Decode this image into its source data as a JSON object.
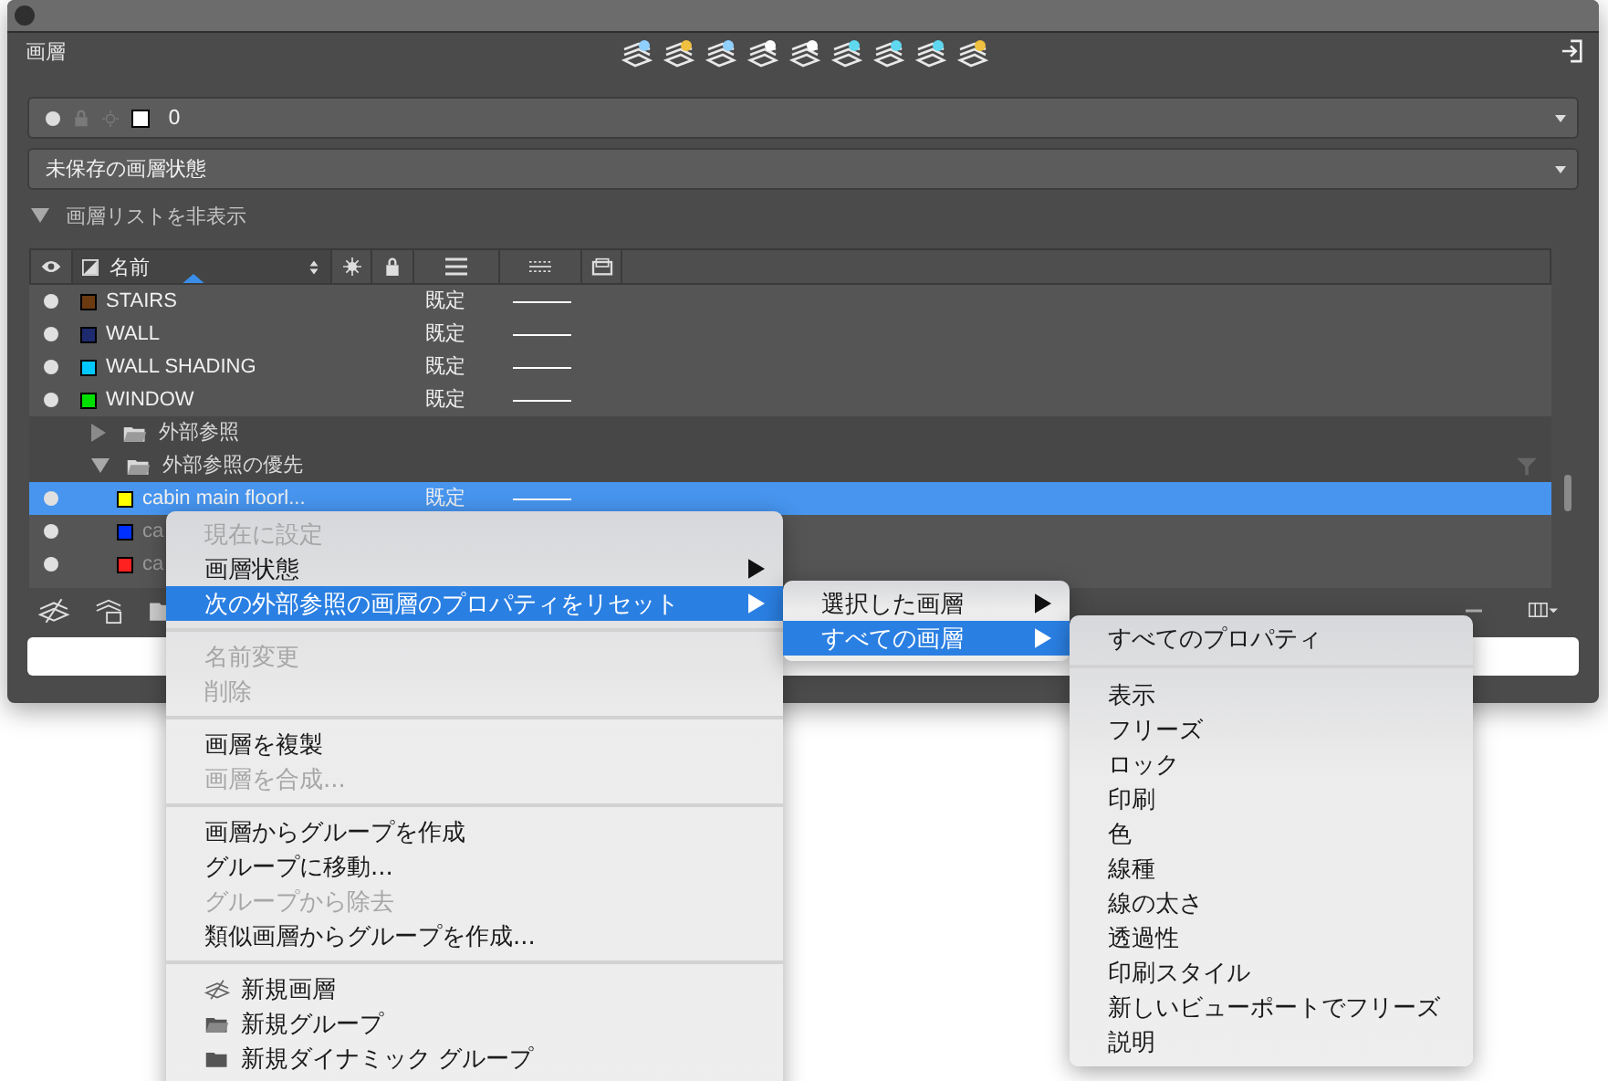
{
  "panel": {
    "title": "画層",
    "current_layer": {
      "name": "0",
      "color": "#ffffff"
    },
    "layer_state": "未保存の画層状態",
    "list_toggle": {
      "label": "画層リストを非表示",
      "expanded": true
    }
  },
  "table": {
    "columns": [
      {
        "label": "名前"
      }
    ],
    "rows": [
      {
        "kind": "layer",
        "name": "STAIRS",
        "color": "#6b3a10",
        "linetype": "既定",
        "selected": false
      },
      {
        "kind": "layer",
        "name": "WALL",
        "color": "#1e2a6e",
        "linetype": "既定",
        "selected": false
      },
      {
        "kind": "layer",
        "name": "WALL SHADING",
        "color": "#00c8ff",
        "linetype": "既定",
        "selected": false
      },
      {
        "kind": "layer",
        "name": "WINDOW",
        "color": "#00e000",
        "linetype": "既定",
        "selected": false
      },
      {
        "kind": "group",
        "name": "外部参照",
        "expanded": false
      },
      {
        "kind": "group",
        "name": "外部参照の優先",
        "expanded": true,
        "children": [
          {
            "kind": "layer",
            "name": "cabin main floorl...",
            "color": "#ffff00",
            "linetype": "既定",
            "selected": true
          },
          {
            "kind": "layer",
            "name": "ca",
            "color": "#0030ff",
            "selected": false
          },
          {
            "kind": "layer",
            "name": "ca",
            "color": "#ff2020",
            "selected": false
          }
        ]
      }
    ]
  },
  "context_menu": {
    "sections": [
      [
        {
          "label": "現在に設定",
          "disabled": true,
          "selected": false,
          "submenu": false
        },
        {
          "label": "画層状態",
          "disabled": false,
          "selected": false,
          "submenu": true
        },
        {
          "label": "次の外部参照の画層のプロパティをリセット",
          "disabled": false,
          "selected": true,
          "submenu": true
        }
      ],
      [
        {
          "label": "名前変更",
          "disabled": true,
          "selected": false,
          "submenu": false
        },
        {
          "label": "削除",
          "disabled": true,
          "selected": false,
          "submenu": false
        }
      ],
      [
        {
          "label": "画層を複製",
          "disabled": false,
          "selected": false,
          "submenu": false
        },
        {
          "label": "画層を合成...",
          "disabled": true,
          "selected": false,
          "submenu": false
        }
      ],
      [
        {
          "label": "画層からグループを作成",
          "disabled": false,
          "selected": false,
          "submenu": false
        },
        {
          "label": "グループに移動...",
          "disabled": false,
          "selected": false,
          "submenu": false
        },
        {
          "label": "グループから除去",
          "disabled": true,
          "selected": false,
          "submenu": false
        },
        {
          "label": "類似画層からグループを作成...",
          "disabled": false,
          "selected": false,
          "submenu": false
        }
      ],
      [
        {
          "label": "新規画層",
          "kind": "new_layer",
          "disabled": false,
          "selected": false,
          "submenu": false
        },
        {
          "label": "新規グループ",
          "kind": "new_group",
          "disabled": false,
          "selected": false,
          "submenu": false
        },
        {
          "label": "新規ダイナミック グループ",
          "kind": "new_dynamic_group",
          "disabled": false,
          "selected": false,
          "submenu": false
        }
      ]
    ]
  },
  "submenu": {
    "sections": [
      [
        {
          "label": "選択した画層",
          "disabled": false,
          "selected": false,
          "submenu": true
        },
        {
          "label": "すべての画層",
          "disabled": false,
          "selected": true,
          "submenu": true
        }
      ]
    ]
  },
  "submenu_2": {
    "sections": [
      [
        {
          "label": "すべてのプロパティ",
          "disabled": false,
          "selected": false,
          "submenu": false
        }
      ],
      [
        {
          "label": "表示",
          "disabled": false,
          "selected": false,
          "submenu": false
        },
        {
          "label": "フリーズ",
          "disabled": false,
          "selected": false,
          "submenu": false
        },
        {
          "label": "ロック",
          "disabled": false,
          "selected": false,
          "submenu": false
        },
        {
          "label": "印刷",
          "disabled": false,
          "selected": false,
          "submenu": false
        },
        {
          "label": "色",
          "disabled": false,
          "selected": false,
          "submenu": false
        },
        {
          "label": "線種",
          "disabled": false,
          "selected": false,
          "submenu": false
        },
        {
          "label": "線の太さ",
          "disabled": false,
          "selected": false,
          "submenu": false
        },
        {
          "label": "透過性",
          "disabled": false,
          "selected": false,
          "submenu": false
        },
        {
          "label": "印刷スタイル",
          "disabled": false,
          "selected": false,
          "submenu": false
        },
        {
          "label": "新しいビューポートでフリーズ",
          "disabled": false,
          "selected": false,
          "submenu": false
        },
        {
          "label": "説明",
          "disabled": false,
          "selected": false,
          "submenu": false
        }
      ]
    ]
  }
}
